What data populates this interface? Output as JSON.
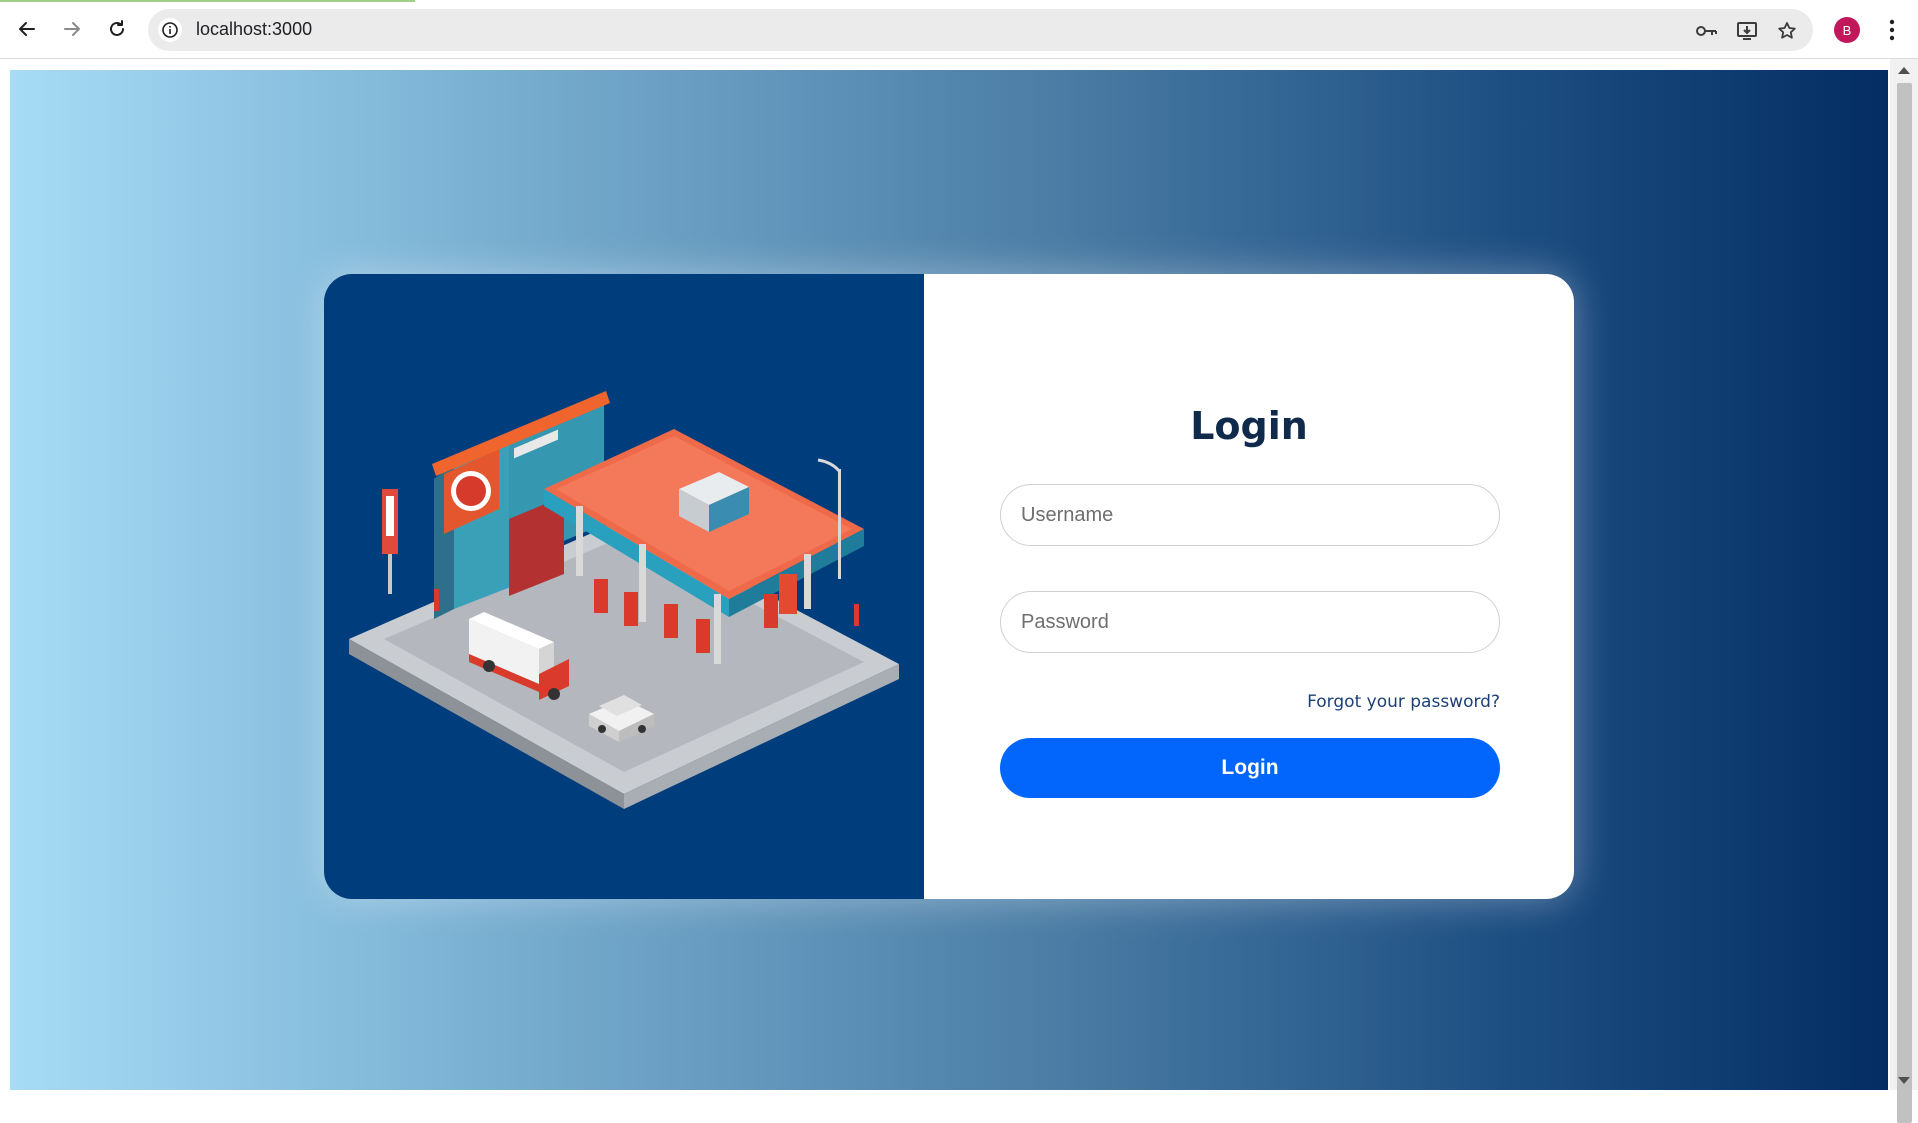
{
  "browser": {
    "url": "localhost:3000",
    "profile_initial": "B",
    "profile_color": "#c2185b"
  },
  "login": {
    "title": "Login",
    "username_placeholder": "Username",
    "password_placeholder": "Password",
    "forgot_label": "Forgot your password?",
    "submit_label": "Login"
  },
  "theme": {
    "accent": "#0266fd",
    "left_panel": "#003d7d",
    "gradient_start": "#a6dcf5",
    "gradient_end": "#032d63"
  }
}
